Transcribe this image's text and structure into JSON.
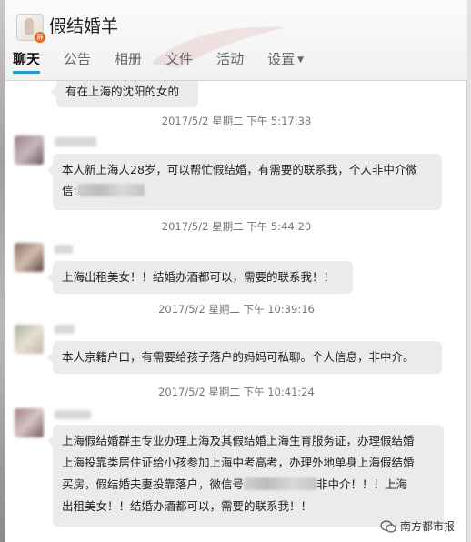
{
  "window": {
    "group_name": "假结婚羊",
    "tabs": [
      {
        "label": "聊天",
        "active": true
      },
      {
        "label": "公告",
        "active": false
      },
      {
        "label": "相册",
        "active": false
      },
      {
        "label": "文件",
        "active": false
      },
      {
        "label": "活动",
        "active": false
      },
      {
        "label": "设置",
        "active": false
      }
    ],
    "accent_color": "#1d9bd6"
  },
  "messages": [
    {
      "text": "有在上海的沈阳的女的"
    },
    {
      "timestamp": "2017/5/2 星期二 下午 5:17:38",
      "line1": "本人新上海人28岁，可以帮忙假结婚，有需要的联系我，个人非中介微",
      "line2": "信:"
    },
    {
      "timestamp": "2017/5/2 星期二 下午 5:44:20",
      "text": "上海出租美女！！结婚办酒都可以，需要的联系我！！"
    },
    {
      "timestamp": "2017/5/2 星期二 下午 10:39:16",
      "text": "本人京籍户口，有需要给孩子落户的妈妈可私聊。个人信息，非中介。"
    },
    {
      "timestamp": "2017/5/2 星期二 下午 10:41:24",
      "line1": "上海假结婚群主专业办理上海及其假结婚上海生育服务证，办理假结婚",
      "line2": "上海投靠类居住证给小孩参加上海中考高考，办理外地单身上海假结婚",
      "line3a": "买房，假结婚夫妻投靠落户，微信号",
      "line3b": "非中介！！！上海",
      "line4": "出租美女！！结婚办酒都可以，需要的联系我！！"
    }
  ],
  "watermark": "南方都市报"
}
